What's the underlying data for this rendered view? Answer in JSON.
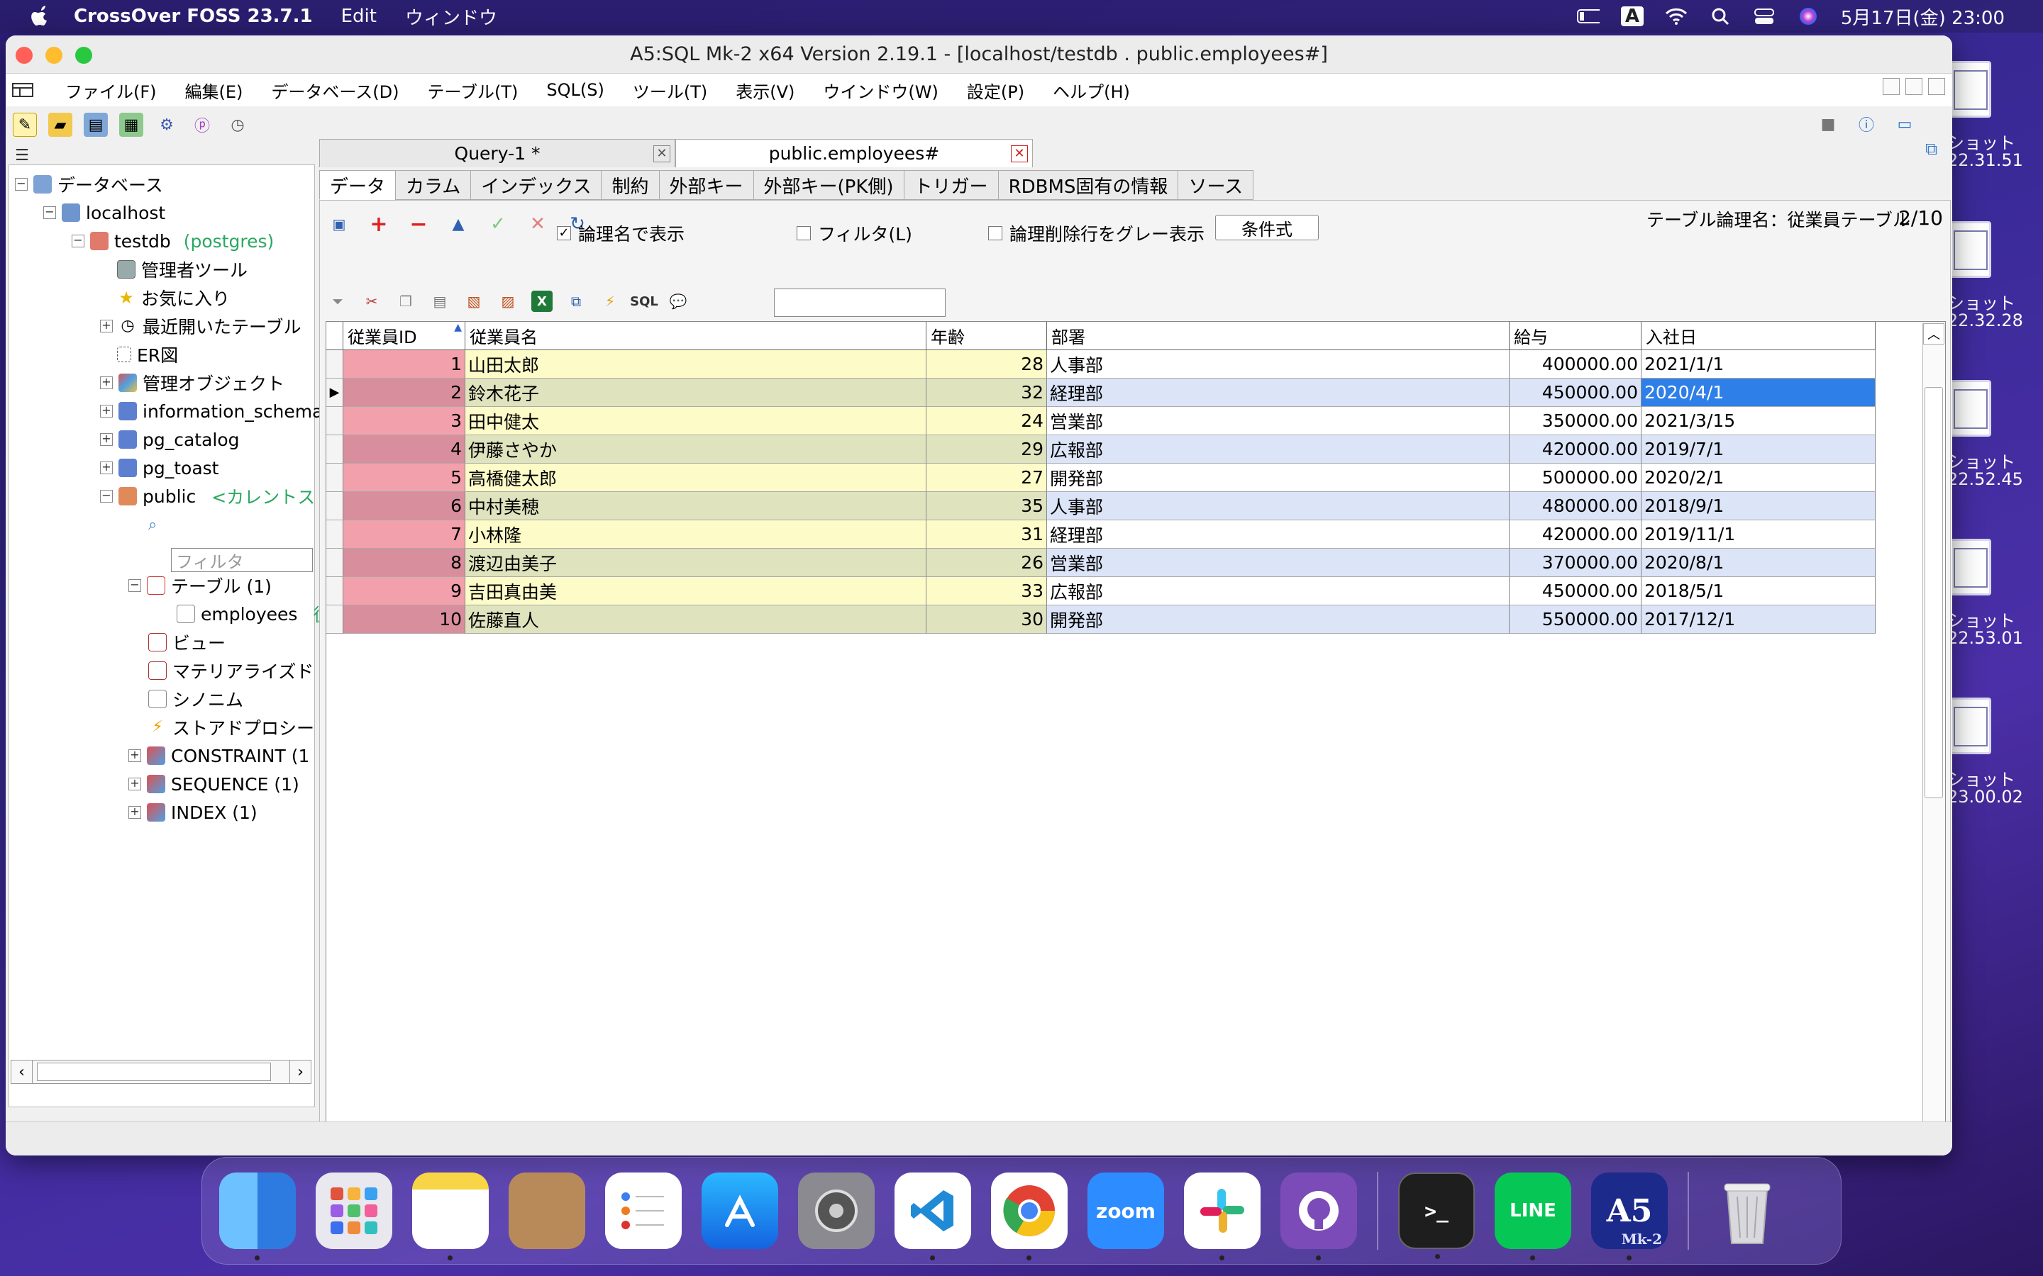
{
  "mac_menubar": {
    "app_name": "CrossOver FOSS 23.7.1",
    "items": [
      "Edit",
      "ウィンドウ"
    ],
    "datetime": "5月17日(金) 23:00",
    "input_mode": "A"
  },
  "desktop_screenshots": [
    {
      "label1": "ショット",
      "label2": "22.31.51"
    },
    {
      "label1": "ショット",
      "label2": "22.32.28"
    },
    {
      "label1": "ショット",
      "label2": "22.52.45"
    },
    {
      "label1": "ショット",
      "label2": "22.53.01"
    },
    {
      "label1": "ショット",
      "label2": "23.00.02"
    }
  ],
  "window": {
    "title": "A5:SQL Mk-2 x64 Version 2.19.1 - [localhost/testdb . public.employees#]"
  },
  "app_menu": [
    "ファイル(F)",
    "編集(E)",
    "データベース(D)",
    "テーブル(T)",
    "SQL(S)",
    "ツール(T)",
    "表示(V)",
    "ウインドウ(W)",
    "設定(P)",
    "ヘルプ(H)"
  ],
  "tree": {
    "root": "データベース",
    "server": "localhost",
    "db": "testdb",
    "db_owner": "(postgres)",
    "admin_tool": "管理者ツール",
    "favorites": "お気に入り",
    "recent": "最近開いたテーブル",
    "er": "ER図",
    "mgmt": "管理オブジェクト",
    "info_schema": "information_schema",
    "pg_catalog": "pg_catalog",
    "pg_toast": "pg_toast",
    "public": "public",
    "public_note": "<カレントス",
    "filter_placeholder": "フィルタ",
    "tables": "テーブル (1)",
    "employees": "employees",
    "employees_note": "従",
    "views": "ビュー",
    "matviews": "マテリアライズド",
    "synonyms": "シノニム",
    "procs": "ストアドプロシー",
    "constraint": "CONSTRAINT (1",
    "sequence": "SEQUENCE (1)",
    "index": "INDEX (1)"
  },
  "doc_tabs": [
    {
      "label": "Query-1 *"
    },
    {
      "label": "public.employees#"
    }
  ],
  "sub_tabs": [
    "データ",
    "カラム",
    "インデックス",
    "制約",
    "外部キー",
    "外部キー(PK側)",
    "トリガー",
    "RDBMS固有の情報",
    "ソース"
  ],
  "controls": {
    "logical_name": "論理名で表示",
    "filter": "フィルタ(L)",
    "gray_deleted": "論理削除行をグレー表示",
    "condition_button": "条件式",
    "table_logical_name": "テーブル論理名：従業員テーブル",
    "page_count": "2/10"
  },
  "toolbar2_sql": "SQL",
  "grid": {
    "headers": [
      "従業員ID",
      "従業員名",
      "年齢",
      "部署",
      "給与",
      "入社日"
    ],
    "rows": [
      [
        "1",
        "山田太郎",
        "28",
        "人事部",
        "400000.00",
        "2021/1/1"
      ],
      [
        "2",
        "鈴木花子",
        "32",
        "経理部",
        "450000.00",
        "2020/4/1"
      ],
      [
        "3",
        "田中健太",
        "24",
        "営業部",
        "350000.00",
        "2021/3/15"
      ],
      [
        "4",
        "伊藤さやか",
        "29",
        "広報部",
        "420000.00",
        "2019/7/1"
      ],
      [
        "5",
        "高橋健太郎",
        "27",
        "開発部",
        "500000.00",
        "2020/2/1"
      ],
      [
        "6",
        "中村美穂",
        "35",
        "人事部",
        "480000.00",
        "2018/9/1"
      ],
      [
        "7",
        "小林隆",
        "31",
        "経理部",
        "420000.00",
        "2019/11/1"
      ],
      [
        "8",
        "渡辺由美子",
        "26",
        "営業部",
        "370000.00",
        "2020/8/1"
      ],
      [
        "9",
        "吉田真由美",
        "33",
        "広報部",
        "450000.00",
        "2018/5/1"
      ],
      [
        "10",
        "佐藤直人",
        "30",
        "開発部",
        "550000.00",
        "2017/12/1"
      ]
    ],
    "selected_row": 2
  },
  "dock": [
    "finder",
    "launchpad",
    "notes",
    "contacts",
    "reminders",
    "app-store",
    "system-settings",
    "vscode",
    "chrome",
    "zoom",
    "slack",
    "github-desktop",
    "terminal",
    "line",
    "a5sql",
    "trash"
  ],
  "dock_labels": {
    "zoom": "zoom",
    "line": "LINE",
    "a5": "A5",
    "a5sub": "Mk-2"
  }
}
